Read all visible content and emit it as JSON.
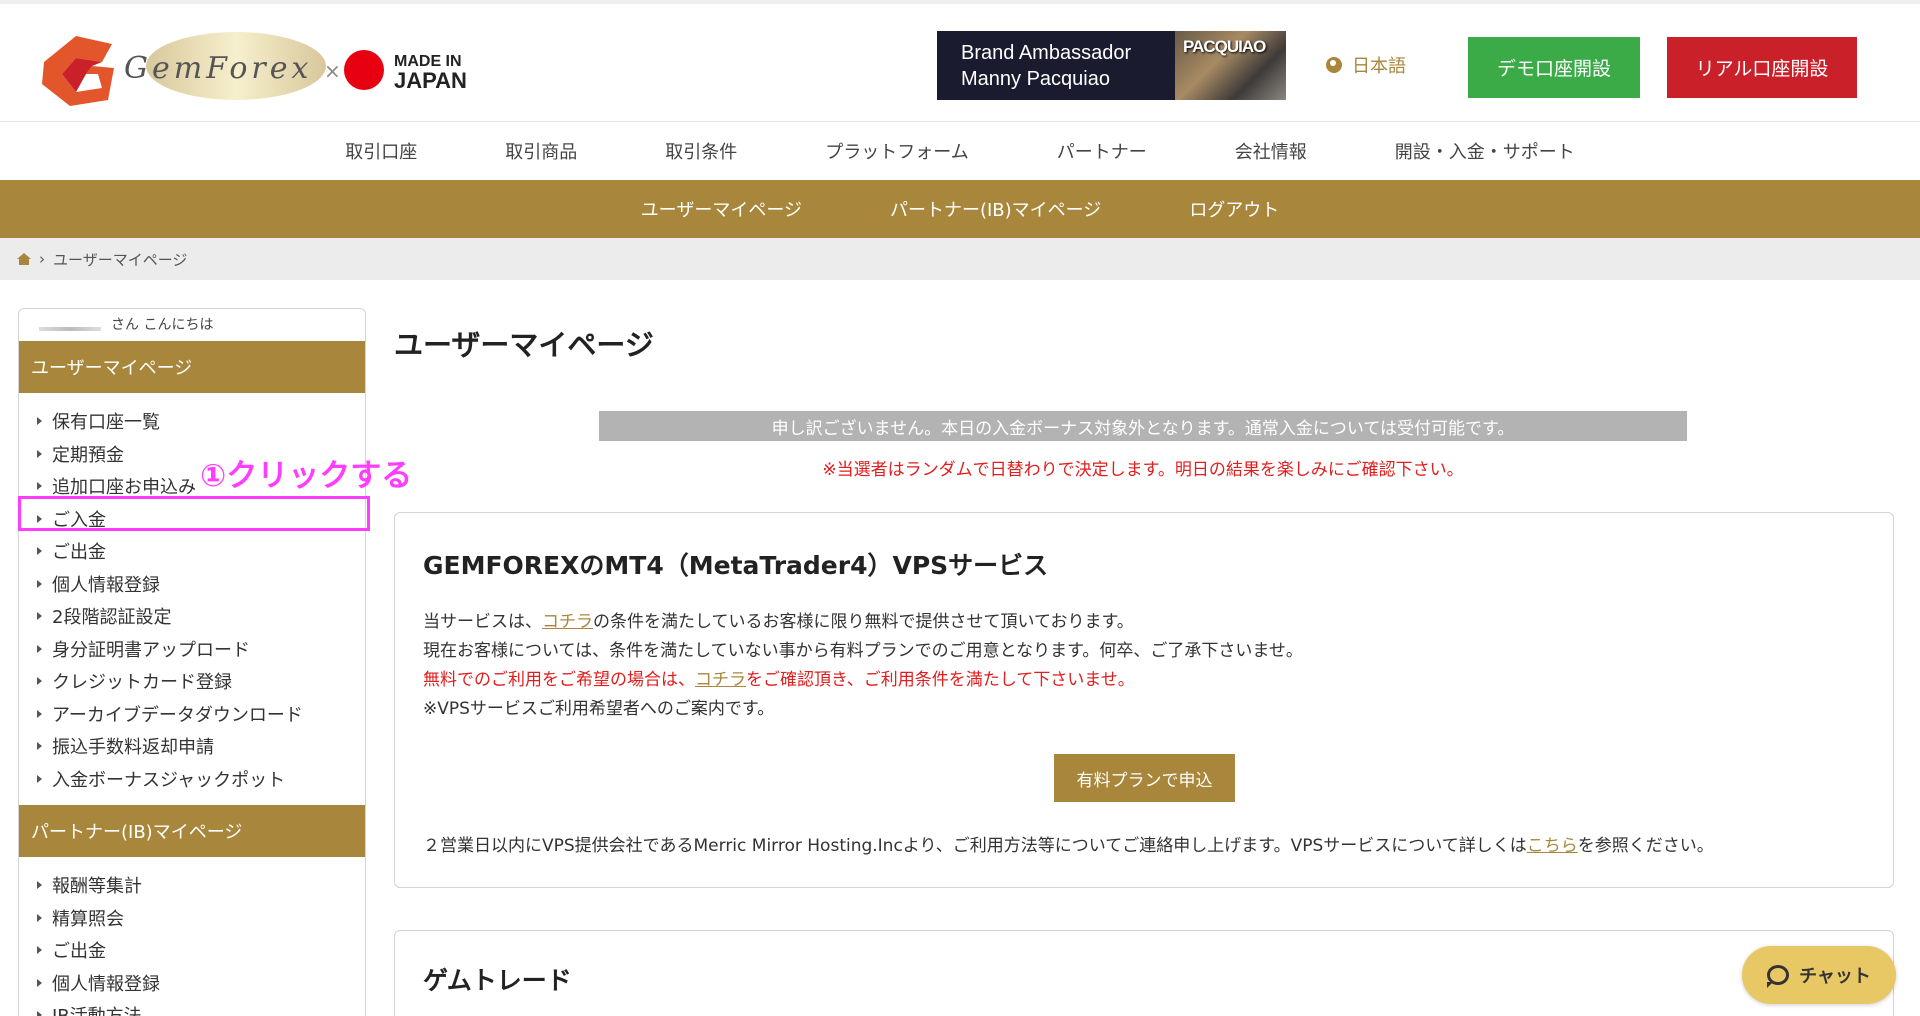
{
  "header": {
    "logo_text": "GemForex",
    "logo_sub": "MADE IN JAPAN",
    "brand_line1": "Brand Ambassador",
    "brand_line2": "Manny Pacquiao",
    "brand_photo_text": "PACQUIAO",
    "language": "日本語",
    "demo_button": "デモ口座開設",
    "real_button": "リアル口座開設"
  },
  "main_nav": [
    "取引口座",
    "取引商品",
    "取引条件",
    "プラットフォーム",
    "パートナー",
    "会社情報",
    "開設・入金・サポート"
  ],
  "sub_nav": [
    "ユーザーマイページ",
    "パートナー(IB)マイページ",
    "ログアウト"
  ],
  "breadcrumb": {
    "current": "ユーザーマイページ"
  },
  "sidebar": {
    "greeting": "さん こんにちは",
    "user_section_title": "ユーザーマイページ",
    "user_items": [
      "保有口座一覧",
      "定期預金",
      "追加口座お申込み",
      "ご入金",
      "ご出金",
      "個人情報登録",
      "2段階認証設定",
      "身分証明書アップロード",
      "クレジットカード登録",
      "アーカイブデータダウンロード",
      "振込手数料返却申請",
      "入金ボーナスジャックポット"
    ],
    "partner_section_title": "パートナー(IB)マイページ",
    "partner_items": [
      "報酬等集計",
      "精算照会",
      "ご出金",
      "個人情報登録",
      "IB活動方法"
    ]
  },
  "annotation": "①クリックする",
  "main": {
    "page_title": "ユーザーマイページ",
    "notice_bar": "申し訳ございません。本日の入金ボーナス対象外となります。通常入金については受付可能です。",
    "notice_red": "※当選者はランダムで日替わりで決定します。明日の結果を楽しみにご確認下さい。",
    "vps": {
      "title": "GEMFOREXのMT4（MetaTrader4）VPSサービス",
      "line1_pre": "当サービスは、",
      "line1_link": "コチラ",
      "line1_post": "の条件を満たしているお客様に限り無料で提供させて頂いております。",
      "line2": "現在お客様については、条件を満たしていない事から有料プランでのご用意となります。何卒、ご了承下さいませ。",
      "line3_pre": "無料でのご利用をご希望の場合は、",
      "line3_link": "コチラ",
      "line3_post": "をご確認頂き、ご利用条件を満たして下さいませ。",
      "line4": "※VPSサービスご利用希望者へのご案内です。",
      "button": "有料プランで申込",
      "foot_pre": "２営業日以内にVPS提供会社であるMerric Mirror Hosting.Incより、ご利用方法等についてご連絡申し上げます。VPSサービスについて詳しくは",
      "foot_link": "こちら",
      "foot_post": "を参照ください。"
    },
    "game_title": "ゲムトレード"
  },
  "chat": {
    "label": "チャット"
  },
  "colors": {
    "gold": "#a8873c",
    "demo_green": "#3aab46",
    "real_red": "#c9202a",
    "highlight": "#ff3cff",
    "chat_yellow": "#e8c765"
  }
}
